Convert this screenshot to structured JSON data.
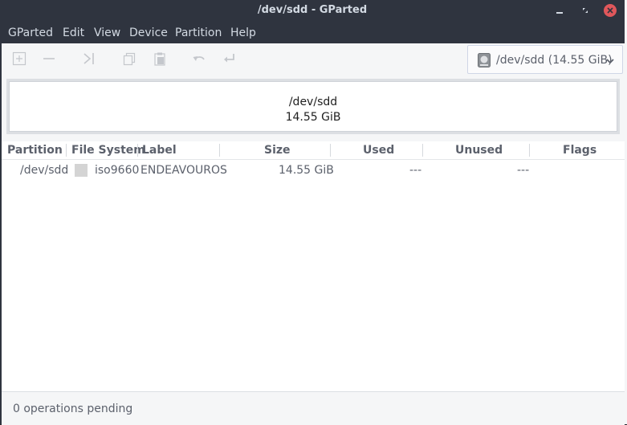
{
  "window": {
    "title": "/dev/sdd - GParted"
  },
  "menubar": {
    "items": [
      "GParted",
      "Edit",
      "View",
      "Device",
      "Partition",
      "Help"
    ]
  },
  "toolbar": {
    "icons": [
      "new-partition-icon",
      "delete-partition-icon",
      "resize-move-icon",
      "copy-icon",
      "paste-icon",
      "undo-icon",
      "apply-icon"
    ],
    "device_selector": "/dev/sdd (14.55 GiB)"
  },
  "disk_visual": {
    "device": "/dev/sdd",
    "size": "14.55 GiB"
  },
  "table": {
    "headers": [
      "Partition",
      "File System",
      "Label",
      "Size",
      "Used",
      "Unused",
      "Flags"
    ],
    "rows": [
      {
        "partition": "/dev/sdd",
        "filesystem": "iso9660",
        "label": "ENDEAVOUROS",
        "size": "14.55 GiB",
        "used": "---",
        "unused": "---",
        "flags": "",
        "fs_color": "#d4d4d4"
      }
    ]
  },
  "status": {
    "text": "0 operations pending"
  },
  "colors": {
    "titlebar": "#2f343f",
    "close_button": "#e0575b",
    "content_bg": "#f5f6f7"
  }
}
